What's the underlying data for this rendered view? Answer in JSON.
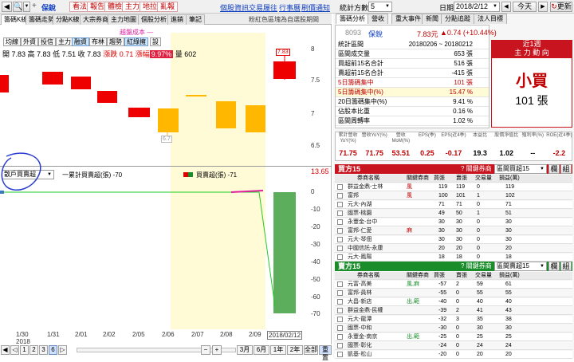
{
  "topbar": {
    "code": "8093",
    "name": "保銳",
    "tools": [
      "看法",
      "報告",
      "體檢",
      "主力",
      "地拉",
      "亂報"
    ],
    "links": [
      "個股資訊",
      "交易履往",
      "行事曆",
      "刷價通知"
    ],
    "range_label": "統計方數:",
    "range_value": "5",
    "date_label": "日期:",
    "date_value": "2018/2/12",
    "today_label": "今天",
    "refresh_label": "更新"
  },
  "tabs": [
    "籌碼K線",
    "籌碼走勢",
    "分點K線",
    "大宗券商",
    "主力地圖",
    "個股分析",
    "進銷",
    "筆記"
  ],
  "tab_hint": "粉紅色區塊為自選股期間",
  "indicator_buttons": [
    "均線",
    "外資",
    "投信",
    "主力",
    "融資",
    "布林",
    "趨勢",
    "紅綠擁",
    "設"
  ],
  "legend_line": "越盤成本 —",
  "quote": {
    "open": "開 7.83",
    "high": "高 7.83",
    "low": "低 7.51",
    "close": "收 7.83",
    "change": "漲跌 0.71",
    "pct_label": "漲幅",
    "pct": "9.97%",
    "vol": "量 602"
  },
  "price_marks": {
    "top": "7.83",
    "low": "6.7"
  },
  "price_axis": [
    "8",
    "7.5",
    "7",
    "6.5"
  ],
  "lower_select": "散戶買賣超",
  "lower_legend1": "一累計買賣超(張) -70",
  "lower_legend2": "買賣超(張) -71",
  "lower_value": "13.65",
  "lower_axis": [
    "0",
    "-10",
    "-20",
    "-30",
    "-40",
    "-50",
    "-60",
    "-70"
  ],
  "dates": [
    "1/30",
    "1/31",
    "2/01",
    "2/02",
    "2/05",
    "2/06",
    "2/07",
    "2/08",
    "2/09",
    "2018/02/12"
  ],
  "year": "2018",
  "periods": [
    "3月",
    "6月",
    "1年",
    "2年",
    "全部",
    "重置"
  ],
  "right_tabs": [
    "籌碼分析",
    "營收",
    "重大事件",
    "新聞",
    "分點追蹤",
    "法人目標"
  ],
  "info": {
    "code": "8093",
    "name": "保銳",
    "price": "7.83元",
    "change": "▲0.74 (+10.44%)",
    "rows": [
      {
        "label": "統計區間",
        "value": "20180206 ~ 20180212"
      },
      {
        "label": "區間成交量",
        "value": "653 張"
      },
      {
        "label": "買超前15名合計",
        "value": "516 張"
      },
      {
        "label": "賣超前15名合計",
        "value": "-415 張"
      },
      {
        "label": "5日籌碼集中",
        "value": "101 張"
      },
      {
        "label": "5日籌碼集中(%)",
        "value": "15.47 %"
      },
      {
        "label": "20日籌碼集中(%)",
        "value": "9.41 %"
      },
      {
        "label": "佔股本比重",
        "value": "0.16 %"
      },
      {
        "label": "區間周轉率",
        "value": "1.02 %"
      }
    ],
    "week_title": "近1週",
    "week_sub": "主 力 動 向",
    "verdict": "小買",
    "verdict_val": "101 張"
  },
  "metrics": {
    "headers": [
      "累計營收YoY(%)",
      "營收YoY(%)",
      "營收MoM(%)",
      "EPS(季)",
      "EPS(近4季)",
      "本益比",
      "股價淨值比",
      "殖利率(%)",
      "ROE(近4季)"
    ],
    "values": [
      "71.75",
      "71.75",
      "53.51",
      "0.25",
      "-0.17",
      "19.3",
      "1.02",
      "--",
      "-2.2"
    ],
    "colors": [
      "#c00000",
      "#c00000",
      "#c00000",
      "#c00000",
      "#c00000",
      "#000000",
      "#000000",
      "#000000",
      "#c00000"
    ]
  },
  "buy": {
    "title": "買方15",
    "hint": "? 關鍵券商",
    "select": "區間買超15",
    "btn1": "欄",
    "btn2": "組",
    "cols": [
      "券商名稱",
      "關鍵券商",
      "買張",
      "賣張",
      "交易量",
      "損益(萬)"
    ],
    "rows": [
      [
        "群益金鼎-士林",
        "風",
        "119",
        "119",
        "0",
        "119"
      ],
      [
        "富邦",
        "風",
        "100",
        "101",
        "1",
        "102"
      ],
      [
        "元大-內湖",
        "",
        "71",
        "71",
        "0",
        "71"
      ],
      [
        "國票-桃園",
        "",
        "49",
        "50",
        "1",
        "51"
      ],
      [
        "永豐金-台中",
        "",
        "30",
        "30",
        "0",
        "30"
      ],
      [
        "富邦-仁愛",
        "麻",
        "30",
        "30",
        "0",
        "30"
      ],
      [
        "元大-琴佃",
        "",
        "30",
        "30",
        "0",
        "30"
      ],
      [
        "中國信託-永康",
        "",
        "20",
        "20",
        "0",
        "20"
      ],
      [
        "元大-鳳陽",
        "",
        "18",
        "18",
        "0",
        "18"
      ]
    ]
  },
  "sell": {
    "title": "賣方15",
    "hint": "? 關鍵券商",
    "select": "區間賣超15",
    "btn1": "欄",
    "btn2": "組",
    "cols": [
      "券商名稱",
      "關鍵券商",
      "買張",
      "賣張",
      "交易量",
      "損益(萬)"
    ],
    "rows": [
      [
        "元富-高美",
        "風,麻",
        "-57",
        "2",
        "59",
        "61"
      ],
      [
        "富邦-員林",
        "",
        "-55",
        "0",
        "55",
        "55"
      ],
      [
        "大昌-新店",
        "出,範",
        "-40",
        "0",
        "40",
        "40"
      ],
      [
        "群益金鼎-民權",
        "",
        "-39",
        "2",
        "41",
        "43"
      ],
      [
        "元大-龍潭",
        "",
        "-32",
        "3",
        "35",
        "38"
      ],
      [
        "國票-中和",
        "",
        "-30",
        "0",
        "30",
        "30"
      ],
      [
        "永豐金-南京",
        "出,範",
        "-25",
        "0",
        "25",
        "25"
      ],
      [
        "國票-彰化",
        "",
        "-24",
        "0",
        "24",
        "24"
      ],
      [
        "凱基-松山",
        "",
        "-20",
        "0",
        "20",
        "20"
      ]
    ]
  },
  "colors": {
    "up": "#ee0000",
    "down": "#ffb700",
    "accent": "#c00000",
    "header_red": "#c8141e",
    "header_green": "#1a8c2a",
    "highlight": "#fffbd6"
  }
}
